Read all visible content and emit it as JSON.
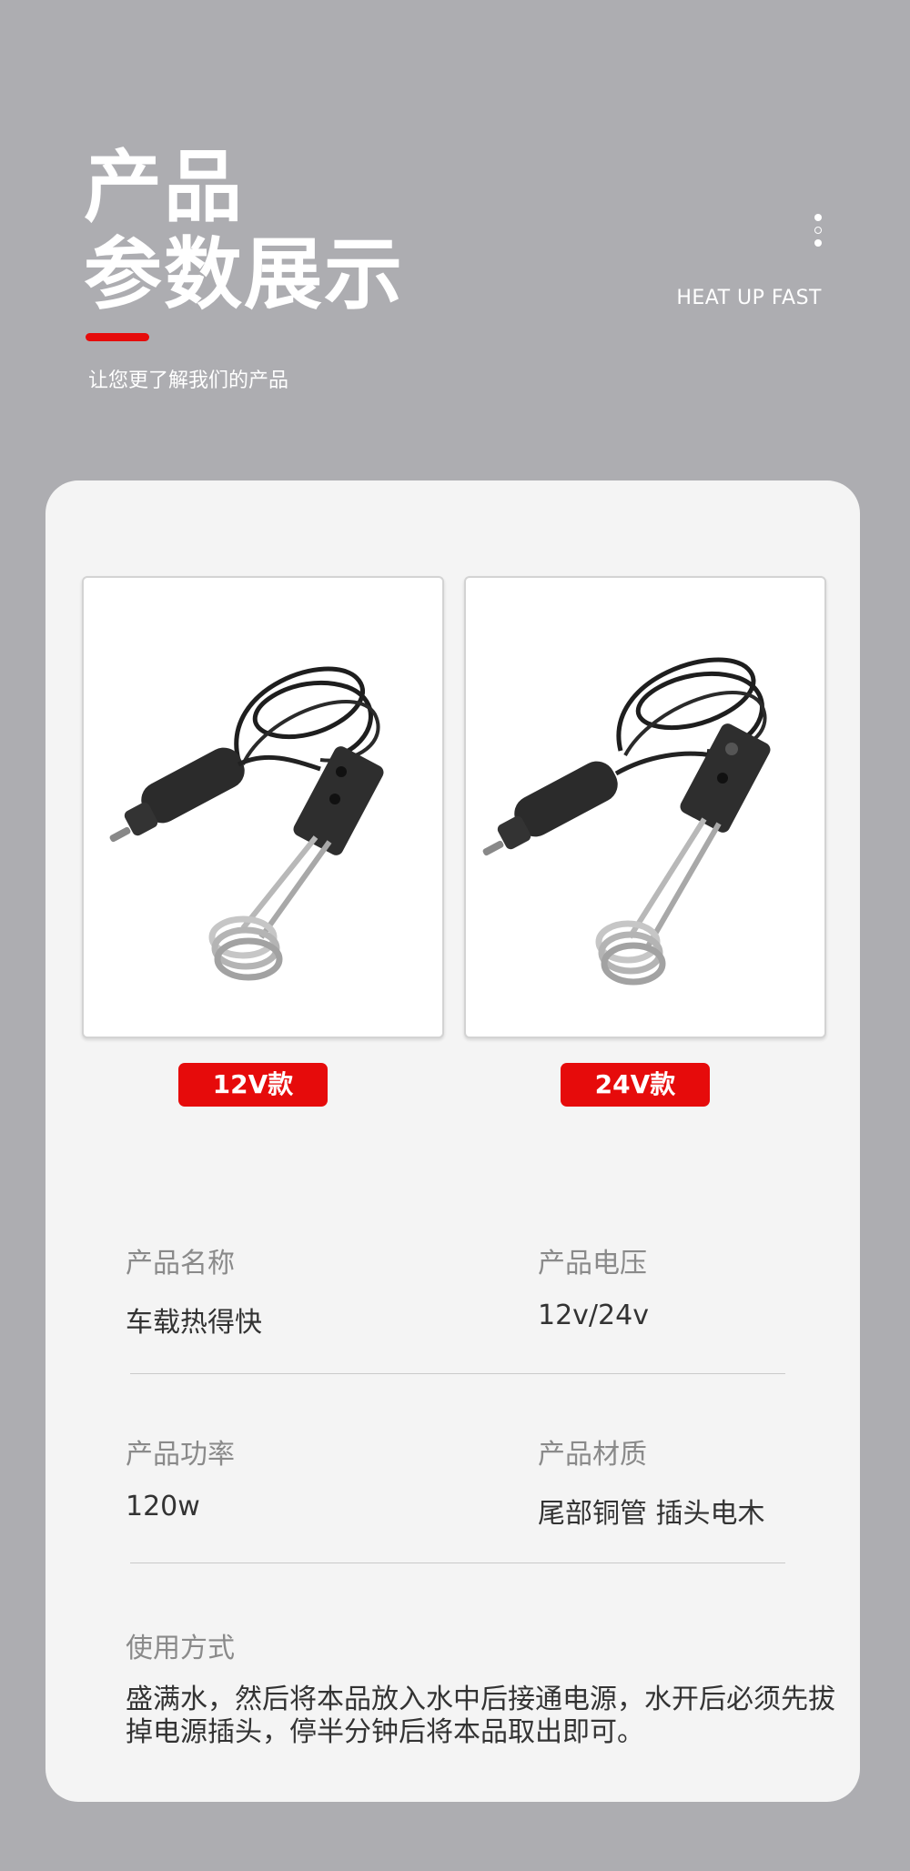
{
  "header": {
    "title_line1": "产品",
    "title_line2": "参数展示",
    "subtitle": "让您更了解我们的产品",
    "tagline": "HEAT UP FAST"
  },
  "products": [
    {
      "tag": "12V款",
      "image_icon": "immersion-heater-image"
    },
    {
      "tag": "24V款",
      "image_icon": "immersion-heater-image"
    }
  ],
  "specs": {
    "name_label": "产品名称",
    "name_value": "车载热得快",
    "voltage_label": "产品电压",
    "voltage_value": "12v/24v",
    "power_label": "产品功率",
    "power_value": "120w",
    "material_label": "产品材质",
    "material_value": "尾部铜管 插头电木",
    "usage_label": "使用方式",
    "usage_value": "盛满水，然后将本品放入水中后接通电源，水开后必须先拔掉电源插头，停半分钟后将本品取出即可。"
  },
  "colors": {
    "background": "#adadb1",
    "card": "#f4f4f4",
    "accent_red": "#e60b0b"
  }
}
